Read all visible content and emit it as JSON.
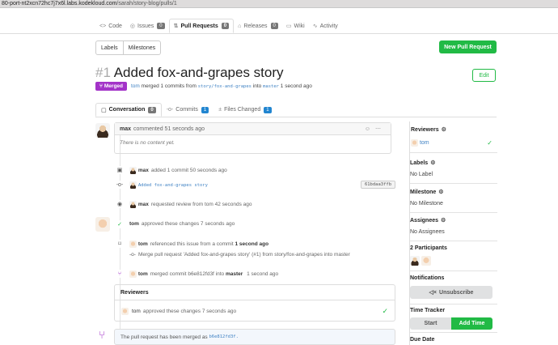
{
  "browser": {
    "url_prefix": "80-port-nt2xcn72hc7j7x6l.labs.kodekloud.com",
    "url_path": "/sarah/story-blog/pulls/1"
  },
  "repo_nav": {
    "code": "Code",
    "issues": {
      "label": "Issues",
      "count": "0"
    },
    "pull_requests": {
      "label": "Pull Requests",
      "count": "0"
    },
    "releases": {
      "label": "Releases",
      "count": "0"
    },
    "wiki": "Wiki",
    "activity": "Activity"
  },
  "filters": {
    "labels": "Labels",
    "milestones": "Milestones"
  },
  "new_pr_button": "New Pull Request",
  "pr": {
    "number": "#1",
    "title": "Added fox-and-grapes story",
    "status": "Merged",
    "merged_by": "tom",
    "merged_text_1": "merged 1 commits from",
    "head_branch": "story/fox-and-grapes",
    "merged_text_2": "into",
    "base_branch": "master",
    "merged_time": "1 second ago",
    "edit_button": "Edit"
  },
  "tabs": {
    "conversation": {
      "label": "Conversation",
      "count": "0"
    },
    "commits": {
      "label": "Commits",
      "count": "1"
    },
    "files_changed": {
      "label": "Files Changed",
      "count": "1"
    }
  },
  "comment": {
    "author": "max",
    "action": "commented",
    "time": "51 seconds ago",
    "body": "There is no content yet."
  },
  "events": {
    "added_commit": {
      "user": "max",
      "text": "added 1 commit 50 seconds ago"
    },
    "commit": {
      "message": "Added fox-and-grapes story",
      "sha": "61bdaa3ffb"
    },
    "review_request": {
      "user": "max",
      "text": "requested review from tom 42 seconds ago"
    },
    "approved": {
      "user": "tom",
      "text": "approved these changes 7 seconds ago"
    },
    "referenced": {
      "user": "tom",
      "text": "referenced this issue from a commit",
      "time": "1 second ago"
    },
    "ref_commit": {
      "text": "Merge pull request 'Added fox-and-grapes story' (#1) from story/fox-and-grapes into master"
    },
    "merged_commit": {
      "user": "tom",
      "text_1": "merged commit b6e812fd3f into",
      "branch": "master",
      "time": "1 second ago"
    }
  },
  "reviewers_box": {
    "title": "Reviewers",
    "user": "tom",
    "text": "approved these changes 7 seconds ago"
  },
  "merged_info": {
    "text": "The pull request has been merged as",
    "sha": "b6e812fd3f."
  },
  "sidebar": {
    "reviewers": {
      "title": "Reviewers",
      "user": "tom"
    },
    "labels": {
      "title": "Labels",
      "value": "No Label"
    },
    "milestone": {
      "title": "Milestone",
      "value": "No Milestone"
    },
    "assignees": {
      "title": "Assignees",
      "value": "No Assignees"
    },
    "participants": {
      "title": "2 Participants"
    },
    "notifications": {
      "title": "Notifications",
      "button": "Unsubscribe"
    },
    "time_tracker": {
      "title": "Time Tracker",
      "start": "Start",
      "add": "Add Time"
    },
    "due_date": {
      "title": "Due Date"
    }
  }
}
